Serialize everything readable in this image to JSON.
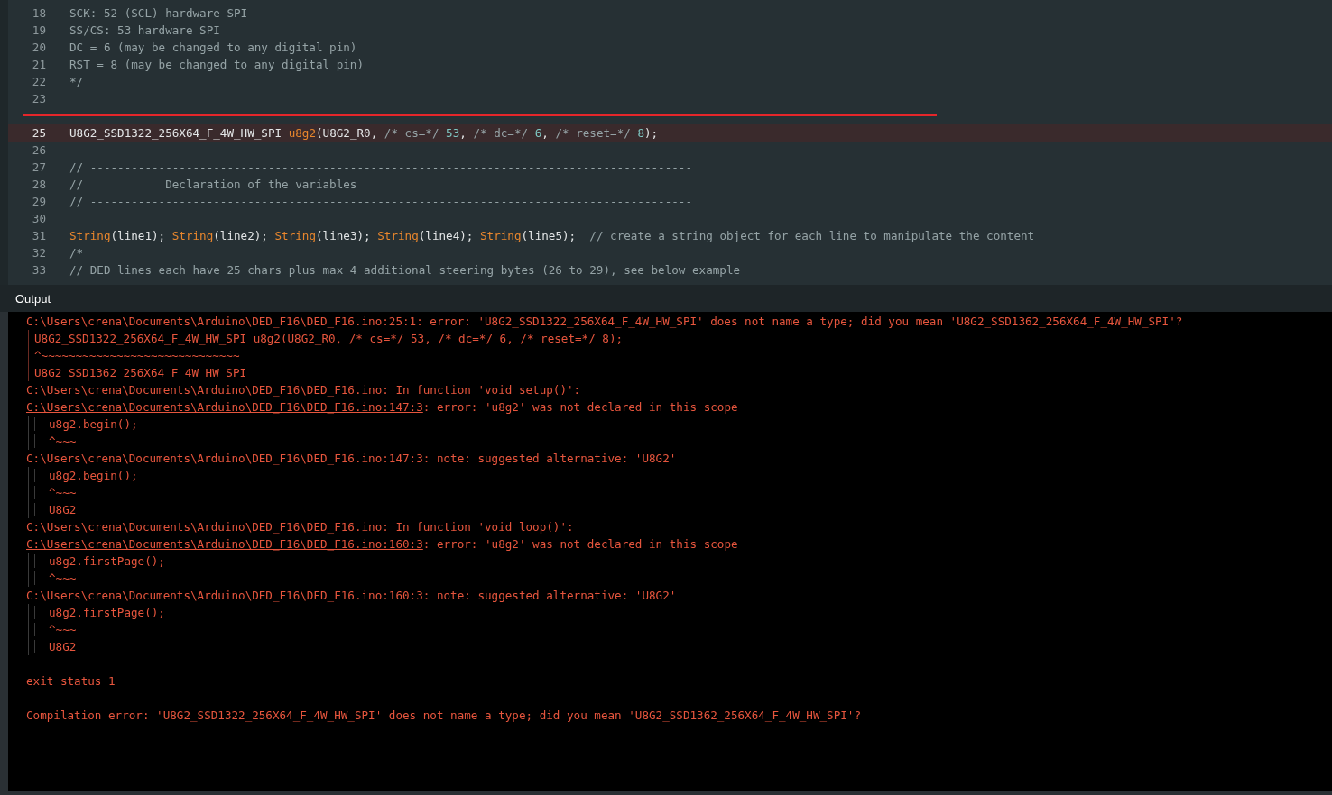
{
  "editor": {
    "lines": [
      {
        "number": "18",
        "highlighted": false,
        "struck": false,
        "segments": [
          {
            "kind": "comment",
            "text": "SCK: 52 (SCL) hardware SPI"
          }
        ]
      },
      {
        "number": "19",
        "highlighted": false,
        "struck": false,
        "segments": [
          {
            "kind": "comment",
            "text": "SS/CS: 53 hardware SPI"
          }
        ]
      },
      {
        "number": "20",
        "highlighted": false,
        "struck": false,
        "segments": [
          {
            "kind": "comment",
            "text": "DC = 6 (may be changed to any digital pin)"
          }
        ]
      },
      {
        "number": "21",
        "highlighted": false,
        "struck": false,
        "segments": [
          {
            "kind": "comment",
            "text": "RST = 8 (may be changed to any digital pin)"
          }
        ]
      },
      {
        "number": "22",
        "highlighted": false,
        "struck": false,
        "segments": [
          {
            "kind": "comment",
            "text": "*/"
          }
        ]
      },
      {
        "number": "23",
        "highlighted": false,
        "struck": false
      },
      {
        "highlighted": false,
        "struck": true
      },
      {
        "number": "25",
        "highlighted": true,
        "struck": false,
        "segments": [
          {
            "kind": "plain",
            "text": "U8G2_SSD1322_256X64_F_4W_HW_SPI "
          },
          {
            "kind": "function",
            "text": "u8g2"
          },
          {
            "kind": "plain",
            "text": "(U8G2_R0, "
          },
          {
            "kind": "comment",
            "text": "/* cs=*/ "
          },
          {
            "kind": "number",
            "text": "53"
          },
          {
            "kind": "plain",
            "text": ", "
          },
          {
            "kind": "comment",
            "text": "/* dc=*/ "
          },
          {
            "kind": "number",
            "text": "6"
          },
          {
            "kind": "plain",
            "text": ", "
          },
          {
            "kind": "comment",
            "text": "/* reset=*/ "
          },
          {
            "kind": "number",
            "text": "8"
          },
          {
            "kind": "plain",
            "text": ");"
          }
        ]
      },
      {
        "number": "26",
        "highlighted": false,
        "struck": false
      },
      {
        "number": "27",
        "highlighted": false,
        "struck": false,
        "segments": [
          {
            "kind": "comment",
            "text": "// ----------------------------------------------------------------------------------------"
          }
        ]
      },
      {
        "number": "28",
        "highlighted": false,
        "struck": false,
        "segments": [
          {
            "kind": "comment",
            "text": "//            Declaration of the variables"
          }
        ]
      },
      {
        "number": "29",
        "highlighted": false,
        "struck": false,
        "segments": [
          {
            "kind": "comment",
            "text": "// ----------------------------------------------------------------------------------------"
          }
        ]
      },
      {
        "number": "30",
        "highlighted": false,
        "struck": false
      },
      {
        "number": "31",
        "highlighted": false,
        "struck": false,
        "segments": [
          {
            "kind": "function",
            "text": "String"
          },
          {
            "kind": "plain",
            "text": "(line1); "
          },
          {
            "kind": "function",
            "text": "String"
          },
          {
            "kind": "plain",
            "text": "(line2); "
          },
          {
            "kind": "function",
            "text": "String"
          },
          {
            "kind": "plain",
            "text": "(line3); "
          },
          {
            "kind": "function",
            "text": "String"
          },
          {
            "kind": "plain",
            "text": "(line4); "
          },
          {
            "kind": "function",
            "text": "String"
          },
          {
            "kind": "plain",
            "text": "(line5);  "
          },
          {
            "kind": "comment",
            "text": "// create a string object for each line to manipulate the content"
          }
        ]
      },
      {
        "number": "32",
        "highlighted": false,
        "struck": false,
        "segments": [
          {
            "kind": "comment",
            "text": "/*"
          }
        ]
      },
      {
        "number": "33",
        "highlighted": false,
        "struck": false,
        "segments": [
          {
            "kind": "comment",
            "text": "// DED lines each have 25 chars plus max 4 additional steering bytes (26 to 29), see below example"
          }
        ]
      }
    ]
  },
  "output": {
    "title": "Output",
    "lines": [
      {
        "kind": "message",
        "text": "C:\\Users\\crena\\Documents\\Arduino\\DED_F16\\DED_F16.ino:25:1: error: 'U8G2_SSD1322_256X64_F_4W_HW_SPI' does not name a type; did you mean 'U8G2_SSD1362_256X64_F_4W_HW_SPI'?"
      },
      {
        "kind": "snippet",
        "text": "U8G2_SSD1322_256X64_F_4W_HW_SPI u8g2(U8G2_R0, /* cs=*/ 53, /* dc=*/ 6, /* reset=*/ 8);"
      },
      {
        "kind": "snippet",
        "text": "^~~~~~~~~~~~~~~~~~~~~~~~~~~~~~"
      },
      {
        "kind": "snippet",
        "text": "U8G2_SSD1362_256X64_F_4W_HW_SPI"
      },
      {
        "kind": "message",
        "text": "C:\\Users\\crena\\Documents\\Arduino\\DED_F16\\DED_F16.ino: In function 'void setup()':"
      },
      {
        "kind": "located",
        "link": "C:\\Users\\crena\\Documents\\Arduino\\DED_F16\\DED_F16.ino:147:3",
        "text": ": error: 'u8g2' was not declared in this scope"
      },
      {
        "kind": "nested",
        "text": "u8g2.begin();"
      },
      {
        "kind": "nested",
        "text": "^~~~"
      },
      {
        "kind": "message",
        "text": "C:\\Users\\crena\\Documents\\Arduino\\DED_F16\\DED_F16.ino:147:3: note: suggested alternative: 'U8G2'"
      },
      {
        "kind": "nested",
        "text": "u8g2.begin();"
      },
      {
        "kind": "nested",
        "text": "^~~~"
      },
      {
        "kind": "nested",
        "text": "U8G2"
      },
      {
        "kind": "message",
        "text": "C:\\Users\\crena\\Documents\\Arduino\\DED_F16\\DED_F16.ino: In function 'void loop()':"
      },
      {
        "kind": "located",
        "link": "C:\\Users\\crena\\Documents\\Arduino\\DED_F16\\DED_F16.ino:160:3",
        "text": ": error: 'u8g2' was not declared in this scope"
      },
      {
        "kind": "nested",
        "text": "u8g2.firstPage();"
      },
      {
        "kind": "nested",
        "text": "^~~~"
      },
      {
        "kind": "message",
        "text": "C:\\Users\\crena\\Documents\\Arduino\\DED_F16\\DED_F16.ino:160:3: note: suggested alternative: 'U8G2'"
      },
      {
        "kind": "nested",
        "text": "u8g2.firstPage();"
      },
      {
        "kind": "nested",
        "text": "^~~~"
      },
      {
        "kind": "nested",
        "text": "U8G2"
      },
      {
        "kind": "blank"
      },
      {
        "kind": "message",
        "text": "exit status 1"
      },
      {
        "kind": "blank"
      },
      {
        "kind": "message",
        "text": "Compilation error: 'U8G2_SSD1322_256X64_F_4W_HW_SPI' does not name a type; did you mean 'U8G2_SSD1362_256X64_F_4W_HW_SPI'?"
      }
    ]
  }
}
